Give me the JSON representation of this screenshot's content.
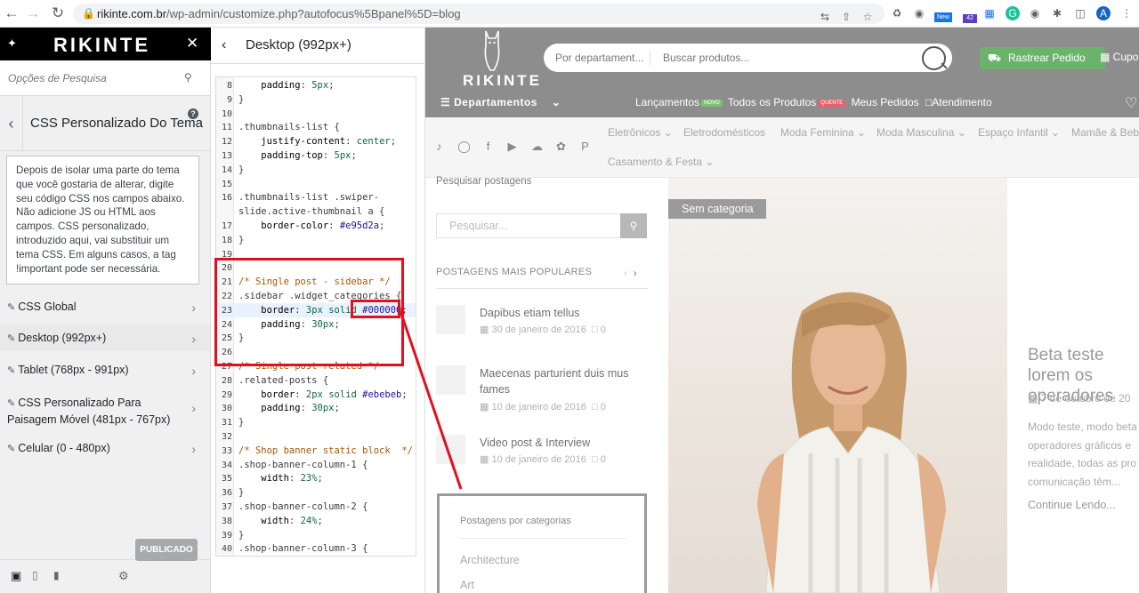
{
  "browser": {
    "url_domain": "rikinte.com.br",
    "url_path": "/wp-admin/customize.php?autofocus%5Bpanel%5D=blog",
    "ext_new_badge": "New",
    "ext_count_badge": "42",
    "profile_initial": "A"
  },
  "customizer": {
    "logo_text": "RIKINTE",
    "search_placeholder": "Opções de Pesquisa",
    "panel_title": "CSS Personalizado Do Tema",
    "help_label": "?",
    "description": "Depois de isolar uma parte do tema que você gostaria de alterar, digite seu código CSS nos campos abaixo. Não adicione JS ou HTML aos campos. CSS personalizado, introduzido aqui, vai substituir um tema CSS. Em alguns casos, a tag !important pode ser necessária.",
    "devices": [
      {
        "label": "CSS Global"
      },
      {
        "label": "Desktop (992px+)"
      },
      {
        "label": "Tablet (768px - 991px)"
      },
      {
        "label": "CSS Personalizado Para Paisagem Móvel (481px - 767px)"
      },
      {
        "label": "Celular (0 - 480px)"
      }
    ],
    "publish_label": "PUBLICADO"
  },
  "code_panel": {
    "title": "Desktop (992px+)",
    "lines": [
      {
        "n": "8",
        "text": "    padding: 5px;"
      },
      {
        "n": "9",
        "text": "}"
      },
      {
        "n": "10",
        "text": ""
      },
      {
        "n": "11",
        "text": ".thumbnails-list {"
      },
      {
        "n": "12",
        "text": "    justify-content: center;"
      },
      {
        "n": "13",
        "text": "    padding-top: 5px;"
      },
      {
        "n": "14",
        "text": "}"
      },
      {
        "n": "15",
        "text": ""
      },
      {
        "n": "16",
        "text": ".thumbnails-list .swiper-"
      },
      {
        "n": "",
        "text": "slide.active-thumbnail a {"
      },
      {
        "n": "17",
        "text": "    border-color: #e95d2a;"
      },
      {
        "n": "18",
        "text": "}"
      },
      {
        "n": "19",
        "text": ""
      },
      {
        "n": "20",
        "text": ""
      },
      {
        "n": "21",
        "text": "/* Single post - sidebar */"
      },
      {
        "n": "22",
        "text": ".sidebar .widget_categories {"
      },
      {
        "n": "23",
        "text": "    border: 3px solid #000000;"
      },
      {
        "n": "24",
        "text": "    padding: 30px;"
      },
      {
        "n": "25",
        "text": "}"
      },
      {
        "n": "26",
        "text": ""
      },
      {
        "n": "27",
        "text": "/* Single post related */"
      },
      {
        "n": "28",
        "text": ".related-posts {"
      },
      {
        "n": "29",
        "text": "    border: 2px solid #ebebeb;"
      },
      {
        "n": "30",
        "text": "    padding: 30px;"
      },
      {
        "n": "31",
        "text": "}"
      },
      {
        "n": "32",
        "text": ""
      },
      {
        "n": "33",
        "text": "/* Shop banner static block  */"
      },
      {
        "n": "34",
        "text": ".shop-banner-column-1 {"
      },
      {
        "n": "35",
        "text": "    width: 23%;"
      },
      {
        "n": "36",
        "text": "}"
      },
      {
        "n": "37",
        "text": ".shop-banner-column-2 {"
      },
      {
        "n": "38",
        "text": "    width: 24%;"
      },
      {
        "n": "39",
        "text": "}"
      },
      {
        "n": "40",
        "text": ".shop-banner-column-3 {"
      }
    ]
  },
  "site": {
    "logo_text": "RIKINTE",
    "search_department": "Por departament...",
    "search_placeholder": "Buscar produtos...",
    "track_label": "Rastrear Pedido",
    "coupon_label": "Cupo",
    "nav_departments": "Departamentos",
    "nav_launches": "Lançamentos",
    "badge_new": "NOVO",
    "nav_all_products": "Todos os Produtos",
    "badge_hot": "QUENTE",
    "nav_orders": "Meus Pedidos",
    "nav_support": "Atendimento",
    "categories": [
      "Eletrônicos",
      "Eletrodomésticos",
      "Moda Feminina",
      "Moda Masculina",
      "Espaço Infantil",
      "Mamãe & Bebê",
      "Casamento & Festa"
    ],
    "search_posts_label": "Pesquisar postagens",
    "search_posts_placeholder": "Pesquisar...",
    "popular_title": "POSTAGENS MAIS POPULARES",
    "posts": [
      {
        "title": "Dapibus etiam tellus",
        "date": "30 de janeiro de 2016",
        "comments": "0"
      },
      {
        "title": "Maecenas parturient duis mus fames",
        "date": "10 de janeiro de 2016",
        "comments": "0"
      },
      {
        "title": "Video post & Interview",
        "date": "10 de janeiro de 2016",
        "comments": "0"
      }
    ],
    "categories_widget_title": "Postagens por categorias",
    "category_items": [
      "Architecture",
      "Art"
    ],
    "hero_badge": "Sem categoria",
    "post_title": "Beta teste lorem os operadores",
    "post_date": "7 de outubro de 20",
    "post_excerpt": "Modo teste, modo beta operadores gráficos e realidade, todas as pro comunicação têm...",
    "read_more": "Continue Lendo..."
  },
  "colors": {
    "annotation_red": "#e2101e",
    "site_header_gray": "#8d8d8d",
    "track_green": "#6bb36b",
    "badge_new_green": "#7cc36f",
    "badge_hot_red": "#e8616a"
  }
}
